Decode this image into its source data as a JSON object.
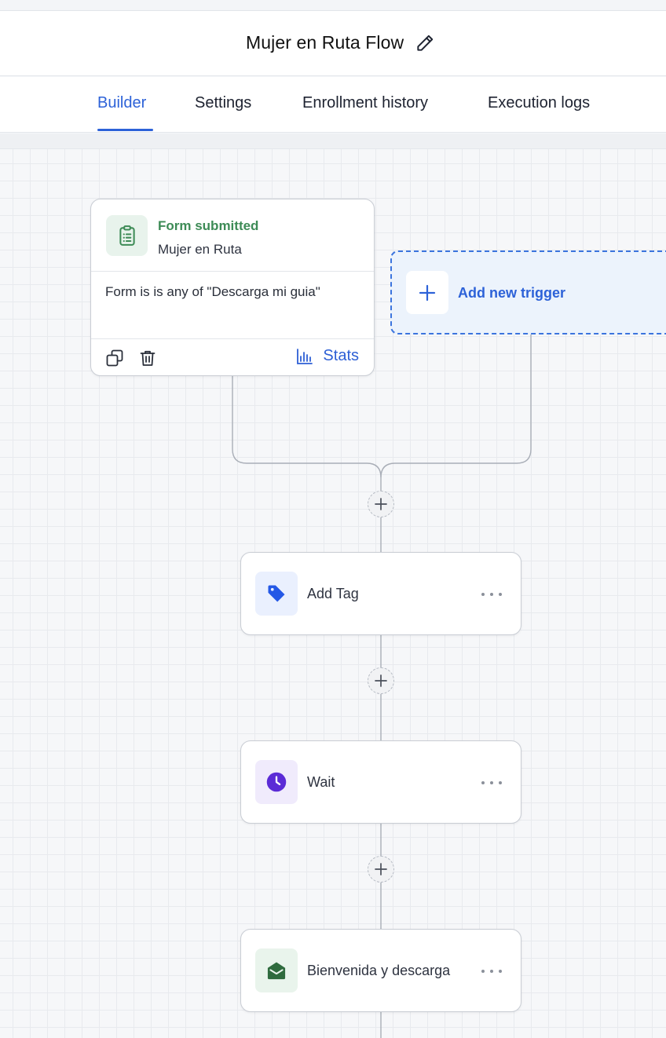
{
  "header": {
    "title": "Mujer en Ruta Flow",
    "edit_icon": "pencil-icon"
  },
  "tabs": [
    {
      "label": "Builder",
      "active": true
    },
    {
      "label": "Settings",
      "active": false
    },
    {
      "label": "Enrollment history",
      "active": false
    },
    {
      "label": "Execution logs",
      "active": false
    }
  ],
  "colors": {
    "accent": "#2d62d8",
    "trigger_green": "#3d8b56",
    "tag_blue": "#2458e6",
    "wait_purple": "#5b2bd6",
    "email_green": "#2f6b3e"
  },
  "trigger": {
    "type": "Form submitted",
    "name": "Mujer en Ruta",
    "condition": "Form is is any of \"Descarga mi guia\"",
    "icon": "clipboard-icon",
    "stats_label": "Stats"
  },
  "add_trigger": {
    "label": "Add new trigger",
    "icon": "plus-icon"
  },
  "steps": [
    {
      "label": "Add Tag",
      "icon": "tag-icon"
    },
    {
      "label": "Wait",
      "icon": "clock-icon"
    },
    {
      "label": "Bienvenida y descarga",
      "icon": "envelope-icon"
    }
  ]
}
